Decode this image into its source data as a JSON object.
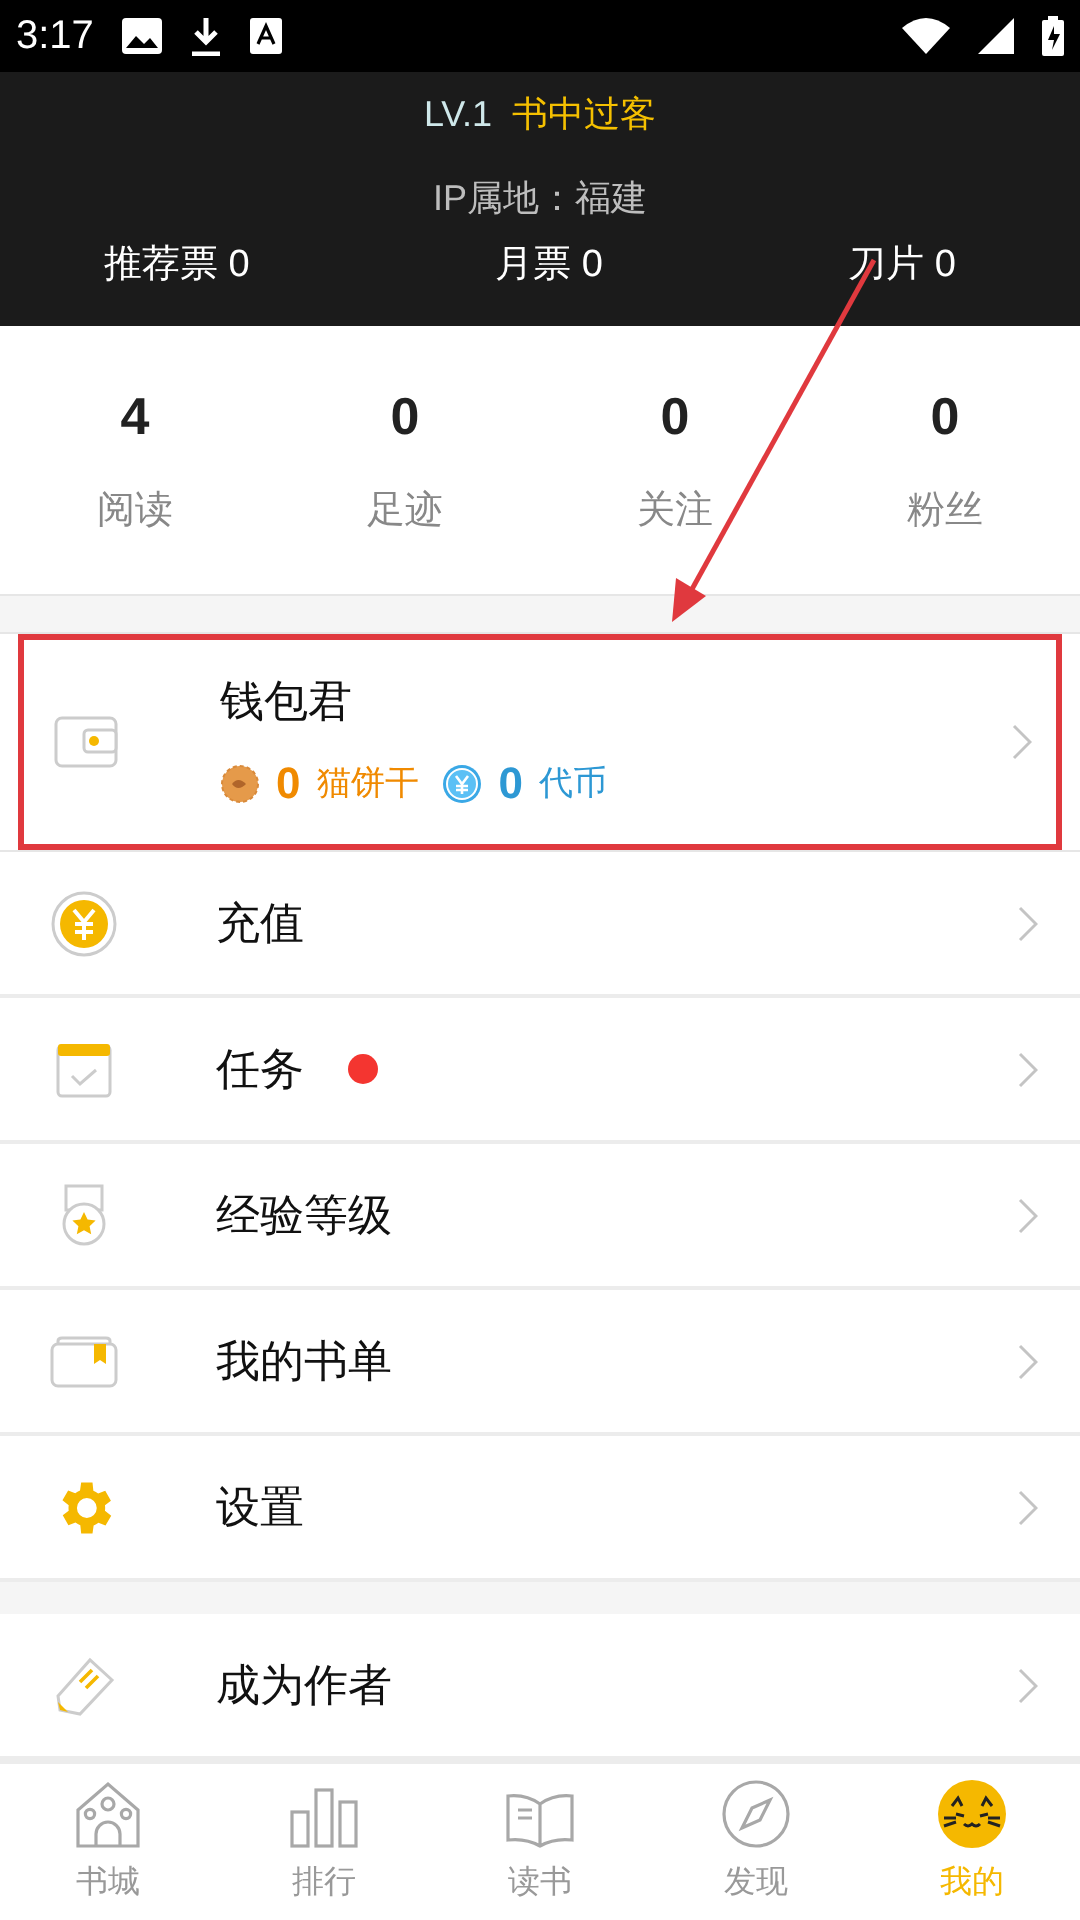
{
  "status_bar": {
    "time": "3:17"
  },
  "header": {
    "level": "LV.1",
    "title": "书中过客",
    "ip": "IP属地：福建",
    "tickets": [
      {
        "label": "推荐票",
        "value": "0"
      },
      {
        "label": "月票",
        "value": "0"
      },
      {
        "label": "刀片",
        "value": "0"
      }
    ]
  },
  "stats": [
    {
      "value": "4",
      "label": "阅读"
    },
    {
      "value": "0",
      "label": "足迹"
    },
    {
      "value": "0",
      "label": "关注"
    },
    {
      "value": "0",
      "label": "粉丝"
    }
  ],
  "wallet": {
    "title": "钱包君",
    "highlighted": true,
    "balances": [
      {
        "kind": "biscuit",
        "amount": "0",
        "label": "猫饼干"
      },
      {
        "kind": "token",
        "amount": "0",
        "label": "代币"
      }
    ]
  },
  "menu_groups": [
    [
      {
        "kind": "recharge",
        "label": "充值",
        "dot": false
      },
      {
        "kind": "task",
        "label": "任务",
        "dot": true
      },
      {
        "kind": "medal",
        "label": "经验等级",
        "dot": false
      },
      {
        "kind": "booklist",
        "label": "我的书单",
        "dot": false
      },
      {
        "kind": "settings",
        "label": "设置",
        "dot": false
      }
    ],
    [
      {
        "kind": "author",
        "label": "成为作者",
        "dot": false
      }
    ]
  ],
  "nav": [
    {
      "kind": "home",
      "label": "书城",
      "selected": false
    },
    {
      "kind": "rank",
      "label": "排行",
      "selected": false
    },
    {
      "kind": "read",
      "label": "读书",
      "selected": false
    },
    {
      "kind": "discover",
      "label": "发现",
      "selected": false
    },
    {
      "kind": "me",
      "label": "我的",
      "selected": true
    }
  ]
}
